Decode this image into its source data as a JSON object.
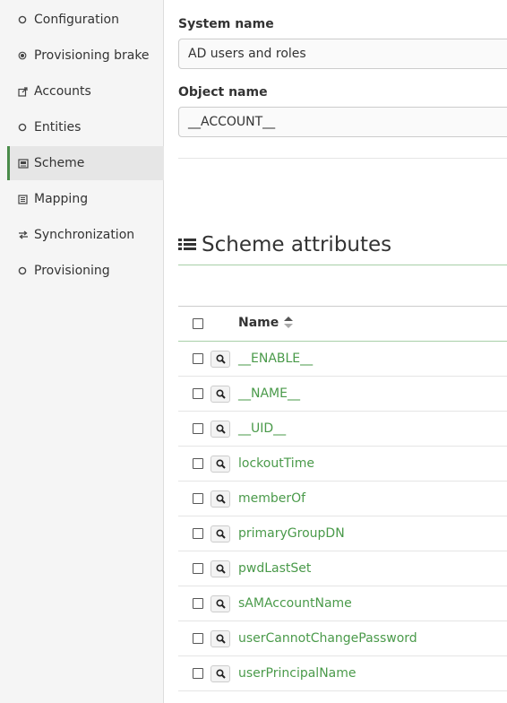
{
  "sidebar": {
    "items": [
      {
        "label": "Configuration",
        "icon": "circle-icon",
        "active": false
      },
      {
        "label": "Provisioning brake",
        "icon": "dot-circle-icon",
        "active": false
      },
      {
        "label": "Accounts",
        "icon": "external-link-icon",
        "active": false
      },
      {
        "label": "Entities",
        "icon": "circle-icon",
        "active": false
      },
      {
        "label": "Scheme",
        "icon": "scheme-icon",
        "active": true
      },
      {
        "label": "Mapping",
        "icon": "list-alt-icon",
        "active": false
      },
      {
        "label": "Synchronization",
        "icon": "exchange-icon",
        "active": false
      },
      {
        "label": "Provisioning",
        "icon": "circle-icon",
        "active": false
      }
    ]
  },
  "form": {
    "system_name_label": "System name",
    "system_name_value": "AD users and roles",
    "object_name_label": "Object name",
    "object_name_value": "__ACCOUNT__"
  },
  "attributes": {
    "title": "Scheme attributes",
    "column_name": "Name",
    "rows": [
      {
        "name": "__ENABLE__"
      },
      {
        "name": "__NAME__"
      },
      {
        "name": "__UID__"
      },
      {
        "name": "lockoutTime"
      },
      {
        "name": "memberOf"
      },
      {
        "name": "primaryGroupDN"
      },
      {
        "name": "pwdLastSet"
      },
      {
        "name": "sAMAccountName"
      },
      {
        "name": "userCannotChangePassword"
      },
      {
        "name": "userPrincipalName"
      }
    ]
  },
  "colors": {
    "accent_green": "#4a9a4a",
    "active_border": "#4a8c4a",
    "sidebar_bg": "#f5f5f5"
  }
}
